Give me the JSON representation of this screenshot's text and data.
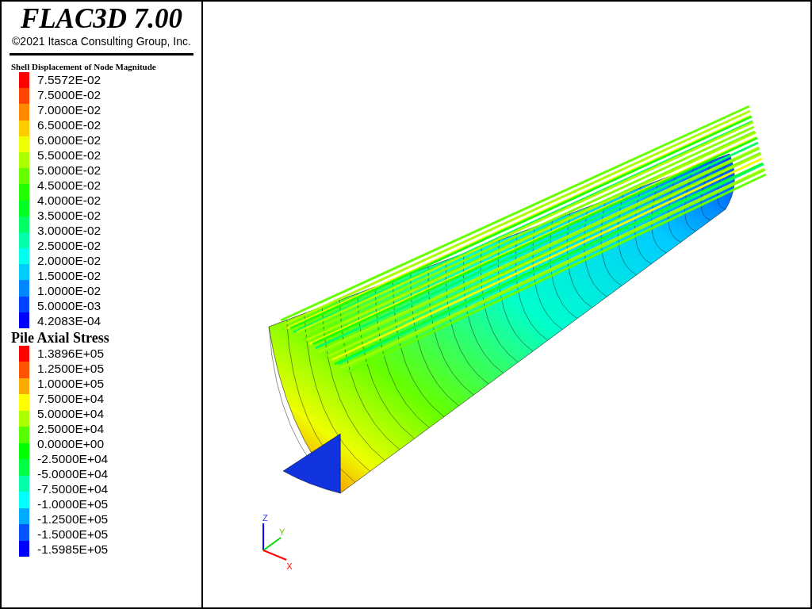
{
  "header": {
    "title": "FLAC3D 7.00",
    "copyright": "©2021 Itasca Consulting Group, Inc."
  },
  "legends": [
    {
      "kind": "small",
      "title": "Shell Displacement of Node Magnitude",
      "labels": [
        "7.5572E-02",
        "7.5000E-02",
        "7.0000E-02",
        "6.5000E-02",
        "6.0000E-02",
        "5.5000E-02",
        "5.0000E-02",
        "4.5000E-02",
        "4.0000E-02",
        "3.5000E-02",
        "3.0000E-02",
        "2.5000E-02",
        "2.0000E-02",
        "1.5000E-02",
        "1.0000E-02",
        "5.0000E-03",
        "4.2083E-04"
      ],
      "bands": [
        {
          "color": "#ff0000"
        },
        {
          "color": "#ff4400"
        },
        {
          "color": "#ff8800"
        },
        {
          "color": "#ffcc00"
        },
        {
          "color": "#eeff00"
        },
        {
          "color": "#aaff00"
        },
        {
          "color": "#66ff00"
        },
        {
          "color": "#22ff00"
        },
        {
          "color": "#00ff22"
        },
        {
          "color": "#00ff66"
        },
        {
          "color": "#00ffaa"
        },
        {
          "color": "#00ffee"
        },
        {
          "color": "#00ccff"
        },
        {
          "color": "#0088ff"
        },
        {
          "color": "#0044ff"
        },
        {
          "color": "#0000ff"
        }
      ]
    },
    {
      "kind": "large",
      "title": "Pile Axial Stress",
      "labels": [
        "1.3896E+05",
        "1.2500E+05",
        "1.0000E+05",
        "7.5000E+04",
        "5.0000E+04",
        "2.5000E+04",
        "0.0000E+00",
        "-2.5000E+04",
        "-5.0000E+04",
        "-7.5000E+04",
        "-1.0000E+05",
        "-1.2500E+05",
        "-1.5000E+05",
        "-1.5985E+05"
      ],
      "bands": [
        {
          "color": "#ff0000"
        },
        {
          "color": "#ff5500"
        },
        {
          "color": "#ffaa00"
        },
        {
          "color": "#ffff00"
        },
        {
          "color": "#aaff00"
        },
        {
          "color": "#55ff00"
        },
        {
          "color": "#00ff00"
        },
        {
          "color": "#00ff44"
        },
        {
          "color": "#00ffaa"
        },
        {
          "color": "#00ffff"
        },
        {
          "color": "#00aaff"
        },
        {
          "color": "#0055ff"
        },
        {
          "color": "#0000ff"
        }
      ]
    }
  ],
  "axes": {
    "x": "X",
    "y": "Y",
    "z": "Z"
  }
}
